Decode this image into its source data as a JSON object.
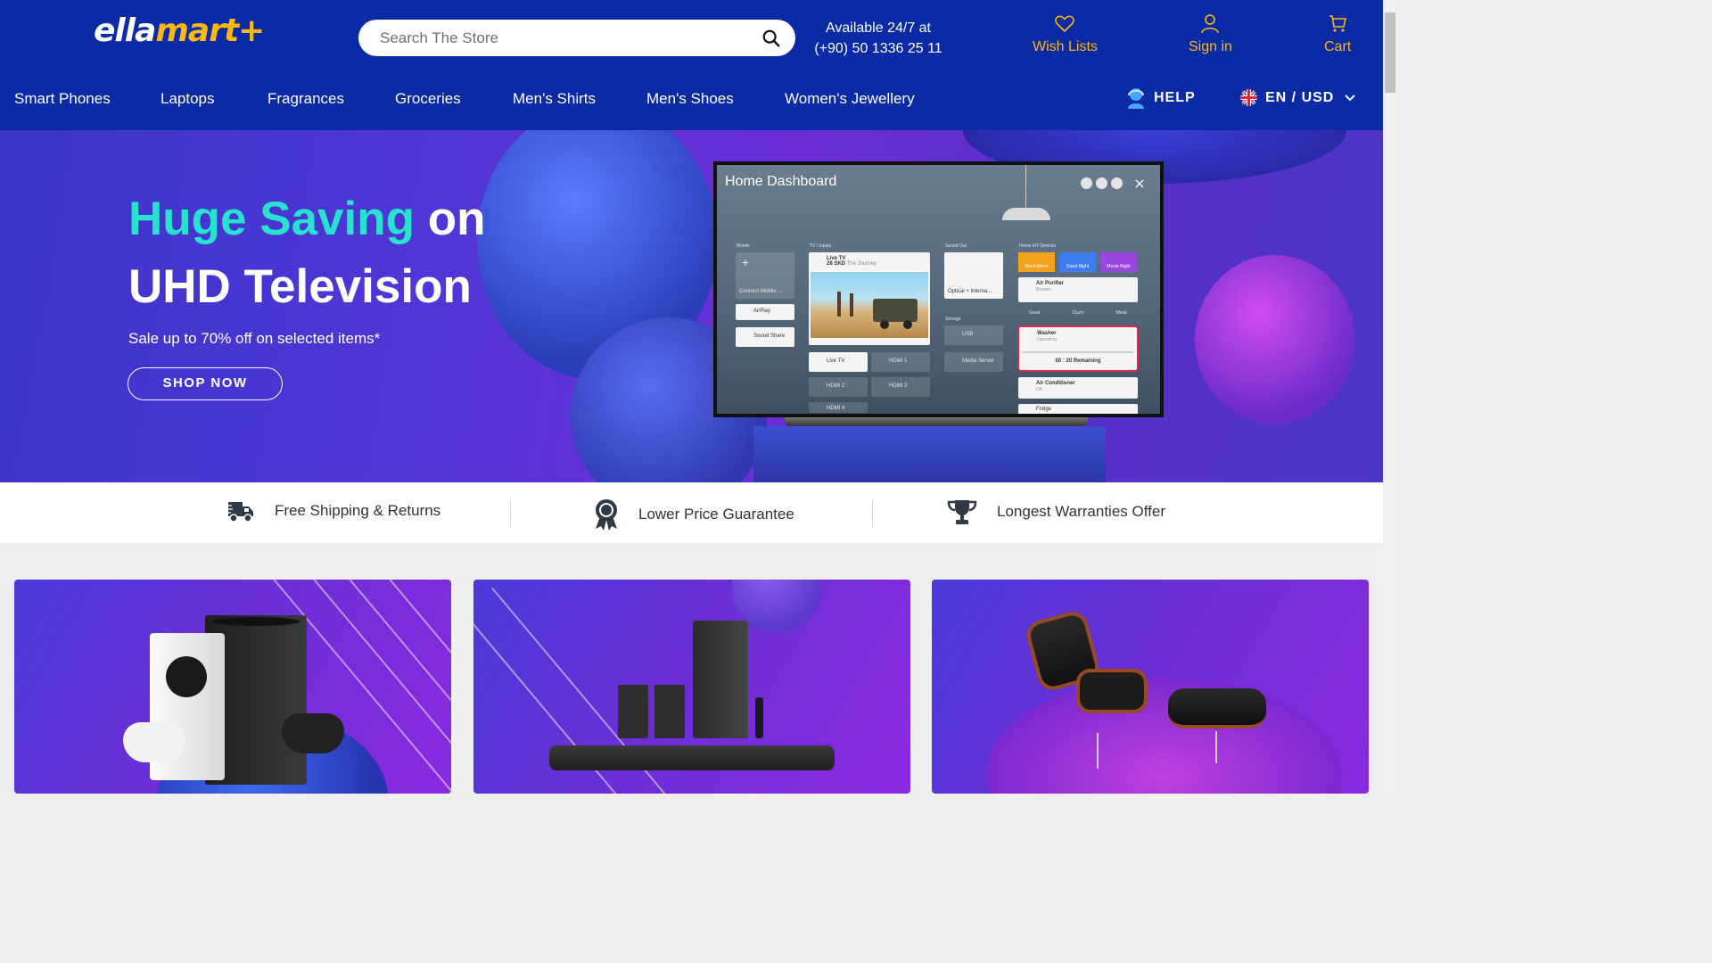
{
  "brand": {
    "logo_part1": "ella",
    "logo_part2": "mart+"
  },
  "search": {
    "placeholder": "Search The Store"
  },
  "contact": {
    "line1": "Available 24/7 at",
    "line2": "(+90) 50 1336 25 11"
  },
  "header_actions": {
    "wishlist": "Wish Lists",
    "signin": "Sign in",
    "cart": "Cart"
  },
  "nav": {
    "items": [
      "Smart Phones",
      "Laptops",
      "Fragrances",
      "Groceries",
      "Men's Shirts",
      "Men's Shoes",
      "Women's Jewellery"
    ],
    "help": "HELP",
    "lang": "EN / USD"
  },
  "hero": {
    "title_highlight": "Huge Saving",
    "title_rest": "on",
    "title_line2": "UHD Television",
    "subtitle": "Sale up to 70% off on selected items*",
    "cta": "SHOP NOW",
    "tv": {
      "dashboard_title": "Home Dashboard",
      "columns": [
        "Mobile",
        "TV / Inputs",
        "Sound Out",
        "Home IoT Devices"
      ],
      "mobile": [
        "Connect Mobile ...",
        "AirPlay",
        "Sound Share"
      ],
      "tv_inputs": {
        "live": "Live TV",
        "channel": "28 SKD",
        "program": "The Journey",
        "inputs": [
          "Live TV",
          "HDMI 1",
          "HDMI 2",
          "HDMI 3",
          "HDMI 4"
        ]
      },
      "sound_out": {
        "optical": "Optical + Interna...",
        "storage": "Storage",
        "usb": "USB",
        "media": "Media Server"
      },
      "iot": {
        "modes": [
          "Good Morni",
          "Good Night",
          "Movie Night"
        ],
        "purifier": "Air Purifier",
        "purifier_status": "Booster",
        "purifier_stats": [
          "Good",
          "12µ/m",
          "Weak"
        ],
        "washer": "Washer",
        "washer_status": "Operating",
        "washer_time": "00 : 20 Remaining",
        "ac": "Air Conditioner",
        "ac_status": "Off",
        "fridge": "Fridge"
      }
    }
  },
  "features": [
    "Free Shipping & Returns",
    "Lower Price Guarantee",
    "Longest Warranties Offer"
  ],
  "colors": {
    "header": "#0a2aa6",
    "accent": "#fbb80f",
    "hero_highlight": "#28e2d0"
  }
}
